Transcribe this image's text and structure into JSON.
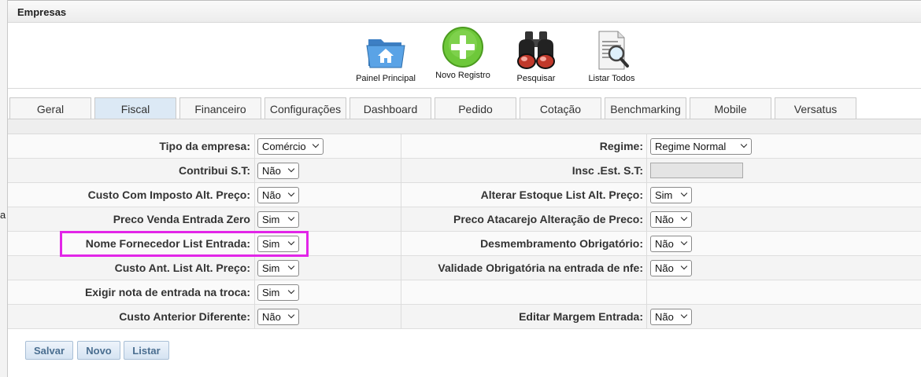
{
  "gutter_text": "a",
  "window": {
    "title": "Empresas"
  },
  "toolbar": [
    {
      "label": "Painel Principal",
      "icon": "folder-home-icon"
    },
    {
      "label": "Novo Registro",
      "icon": "plus-circle-icon"
    },
    {
      "label": "Pesquisar",
      "icon": "binoculars-icon"
    },
    {
      "label": "Listar Todos",
      "icon": "document-search-icon"
    }
  ],
  "tabs": [
    {
      "label": "Geral",
      "active": false
    },
    {
      "label": "Fiscal",
      "active": true
    },
    {
      "label": "Financeiro",
      "active": false
    },
    {
      "label": "Configurações",
      "active": false
    },
    {
      "label": "Dashboard",
      "active": false
    },
    {
      "label": "Pedido",
      "active": false
    },
    {
      "label": "Cotação",
      "active": false
    },
    {
      "label": "Benchmarking",
      "active": false
    },
    {
      "label": "Mobile",
      "active": false
    },
    {
      "label": "Versatus",
      "active": false
    }
  ],
  "form": {
    "rows": [
      {
        "left": {
          "label": "Tipo da empresa:",
          "value": "Comércio"
        },
        "right": {
          "label": "Regime:",
          "value": "Regime Normal"
        }
      },
      {
        "left": {
          "label": "Contribui S.T:",
          "value": "Não"
        },
        "right": {
          "label": "Insc .Est. S.T:",
          "value": ""
        }
      },
      {
        "left": {
          "label": "Custo Com Imposto Alt. Preço:",
          "value": "Não"
        },
        "right": {
          "label": "Alterar Estoque List Alt. Preço:",
          "value": "Sim"
        }
      },
      {
        "left": {
          "label": "Preco Venda Entrada Zero",
          "value": "Sim"
        },
        "right": {
          "label": "Preco Atacarejo Alteração de Preco:",
          "value": "Não"
        }
      },
      {
        "left": {
          "label": "Nome Fornecedor List Entrada:",
          "value": "Sim"
        },
        "right": {
          "label": "Desmembramento Obrigatório:",
          "value": "Não"
        }
      },
      {
        "left": {
          "label": "Custo Ant. List Alt. Preço:",
          "value": "Sim"
        },
        "right": {
          "label": "Validade Obrigatória na entrada de nfe:",
          "value": "Não"
        }
      },
      {
        "left": {
          "label": "Exigir nota de entrada na troca:",
          "value": "Sim"
        },
        "right": {
          "label": "",
          "value": ""
        }
      },
      {
        "left": {
          "label": "Custo Anterior Diferente:",
          "value": "Não"
        },
        "right": {
          "label": "Editar Margem Entrada:",
          "value": "Não"
        }
      }
    ]
  },
  "actions": {
    "save": "Salvar",
    "new": "Novo",
    "list": "Listar"
  },
  "colors": {
    "active_tab": "#dce9f5",
    "highlight": "#e225e8",
    "button_text": "#4a6e90"
  }
}
